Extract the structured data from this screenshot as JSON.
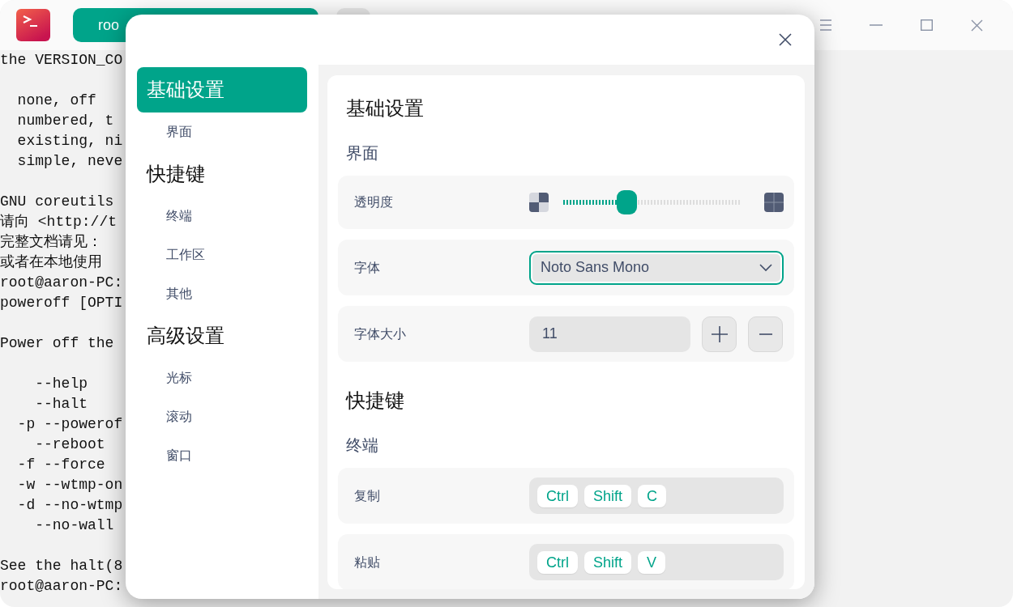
{
  "terminal": {
    "tabs": [
      {
        "label": "roo",
        "selected": true
      }
    ],
    "blocks": [
      {
        "lines": [
          "the VERSION_CO"
        ]
      },
      {
        "lines": [
          "  none, off",
          "  numbered, t",
          "  existing, ni",
          "  simple, neve"
        ]
      },
      {
        "lines": [
          "GNU coreutils",
          "请向 <http://t",
          "完整文档请见：",
          "或者在本地使用",
          "root@aaron-PC:",
          "poweroff [OPTI"
        ]
      },
      {
        "lines": [
          "Power off the"
        ]
      },
      {
        "lines": [
          "    --help",
          "    --halt",
          "  -p --powerof",
          "    --reboot",
          "  -f --force",
          "  -w --wtmp-on",
          "  -d --no-wtmp",
          "    --no-wall"
        ]
      },
      {
        "lines": [
          "See the halt(8",
          "root@aaron-PC:"
        ]
      }
    ]
  },
  "dialog": {
    "nav": [
      {
        "label": "基础设置",
        "selected": true,
        "children": [
          {
            "label": "界面",
            "selected": false
          }
        ]
      },
      {
        "label": "快捷键",
        "selected": false,
        "children": [
          {
            "label": "终端",
            "selected": false
          },
          {
            "label": "工作区",
            "selected": false
          },
          {
            "label": "其他",
            "selected": false
          }
        ]
      },
      {
        "label": "高级设置",
        "selected": false,
        "children": [
          {
            "label": "光标",
            "selected": false
          },
          {
            "label": "滚动",
            "selected": false
          },
          {
            "label": "窗口",
            "selected": false
          }
        ]
      }
    ],
    "sections": [
      {
        "title": "基础设置",
        "groups": [
          {
            "title": "界面",
            "rows": [
              {
                "kind": "slider",
                "label": "透明度",
                "level": 0.34
              },
              {
                "kind": "select",
                "label": "字体",
                "value": "Noto Sans Mono"
              },
              {
                "kind": "spin",
                "label": "字体大小",
                "value": "11"
              }
            ]
          }
        ]
      },
      {
        "title": "快捷键",
        "groups": [
          {
            "title": "终端",
            "rows": [
              {
                "kind": "keys",
                "label": "复制",
                "keys": [
                  "Ctrl",
                  "Shift",
                  "C"
                ]
              },
              {
                "kind": "keys",
                "label": "粘贴",
                "keys": [
                  "Ctrl",
                  "Shift",
                  "V"
                ]
              }
            ]
          }
        ]
      }
    ]
  }
}
